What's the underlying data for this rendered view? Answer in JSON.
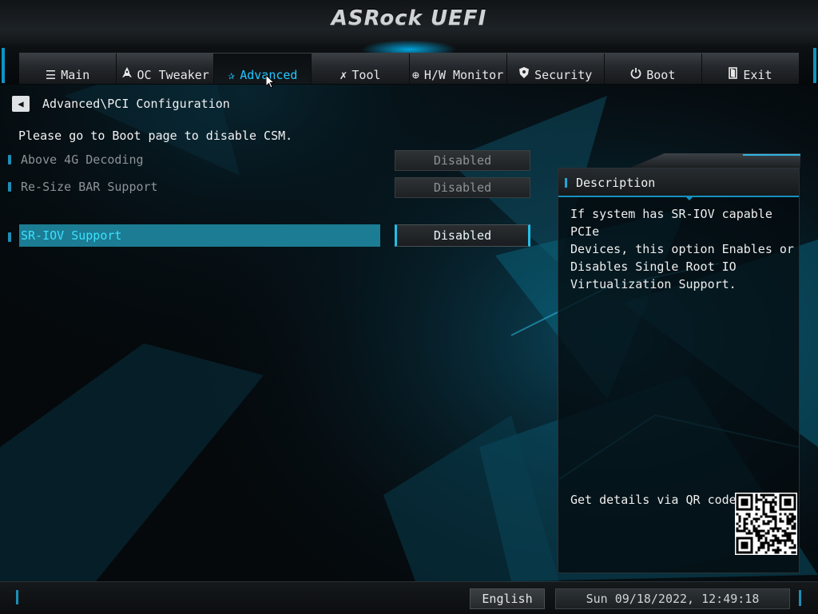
{
  "header": {
    "logo_text": "ASRock UEFI"
  },
  "nav": {
    "tabs": [
      {
        "label": "Main",
        "icon": "list-icon",
        "glyph": "☰",
        "active": false
      },
      {
        "label": "OC Tweaker",
        "icon": "rocket-icon",
        "glyph": "🚀",
        "active": false
      },
      {
        "label": "Advanced",
        "icon": "star-icon",
        "glyph": "✰",
        "active": true
      },
      {
        "label": "Tool",
        "icon": "tools-icon",
        "glyph": "✗",
        "active": false
      },
      {
        "label": "H/W Monitor",
        "icon": "monitor-dial-icon",
        "glyph": "⊕",
        "active": false
      },
      {
        "label": "Security",
        "icon": "shield-icon",
        "glyph": "⛨",
        "active": false
      },
      {
        "label": "Boot",
        "icon": "power-icon",
        "glyph": "⏻",
        "active": false
      },
      {
        "label": "Exit",
        "icon": "exit-door-icon",
        "glyph": "⎗",
        "active": false
      }
    ]
  },
  "breadcrumb": {
    "path": "Advanced\\PCI Configuration",
    "back_icon": "back-arrow-icon"
  },
  "notice": "Please go to Boot page to disable CSM.",
  "settings": [
    {
      "label": "Above 4G Decoding",
      "value": "Disabled",
      "enabled": false,
      "selected": false
    },
    {
      "label": "Re-Size BAR Support",
      "value": "Disabled",
      "enabled": false,
      "selected": false
    },
    {
      "label": "SR-IOV Support",
      "value": "Disabled",
      "enabled": true,
      "selected": true
    }
  ],
  "description": {
    "title": "Description",
    "lines": [
      "If system has SR-IOV capable PCIe",
      "Devices, this option Enables or",
      "Disables Single Root IO",
      "Virtualization Support."
    ],
    "qr_label": "Get details via QR code"
  },
  "footer": {
    "language": "English",
    "datetime": "Sun 09/18/2022, 12:49:18"
  },
  "colors": {
    "accent": "#21c8ff",
    "selected_row": "#1b7c93",
    "disabled_text": "#8d9296"
  }
}
